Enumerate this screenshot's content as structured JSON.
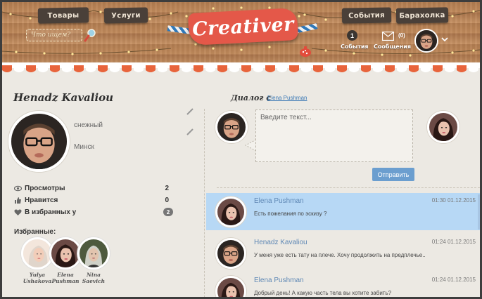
{
  "nav": {
    "goods": "Товары",
    "services": "Услуги",
    "events": "События",
    "market": "Барахолка"
  },
  "search": {
    "placeholder": "Что ищем?"
  },
  "logo": {
    "text": "Creativer"
  },
  "header_stats": {
    "events_count": "1",
    "events_label": "События",
    "messages_count": "(0)",
    "messages_label": "Сообщения"
  },
  "profile": {
    "name": "Henadz Kavaliou",
    "status": "снежный",
    "city": "Минск",
    "stats": [
      {
        "label": "Просмотры",
        "value": "2",
        "icon": "eye-icon"
      },
      {
        "label": "Нравится",
        "value": "0",
        "icon": "thumb-icon"
      },
      {
        "label": "В избранных у",
        "value": "2",
        "icon": "heart-icon"
      }
    ],
    "favorites_title": "Избранные:",
    "favorites": [
      {
        "first": "Yulya",
        "last": "Ushakova"
      },
      {
        "first": "Elena",
        "last": "Pushman"
      },
      {
        "first": "Nina",
        "last": "Saevich"
      }
    ]
  },
  "dialog": {
    "title": "Диалог с",
    "with": "Elena Pushman",
    "compose_placeholder": "Введите текст...",
    "send_label": "Отправить"
  },
  "messages": [
    {
      "author": "Elena Pushman",
      "time": "01:30 01.12.2015",
      "text": "Есть пожелания по эскизу ?"
    },
    {
      "author": "Henadz Kavaliou",
      "time": "01:24 01.12.2015",
      "text": "У меня уже есть тату на плече. Хочу продолжить на предплечье.."
    },
    {
      "author": "Elena Pushman",
      "time": "01:24 01.12.2015",
      "text": "Добрый день! А какую часть тела вы хотите забить?"
    }
  ],
  "colors": {
    "accent_red": "#e45849",
    "link_blue": "#3a78b5",
    "send_blue": "#6b9ecf",
    "active_row": "#b7d8f5",
    "nav_dark": "#4a4039"
  }
}
